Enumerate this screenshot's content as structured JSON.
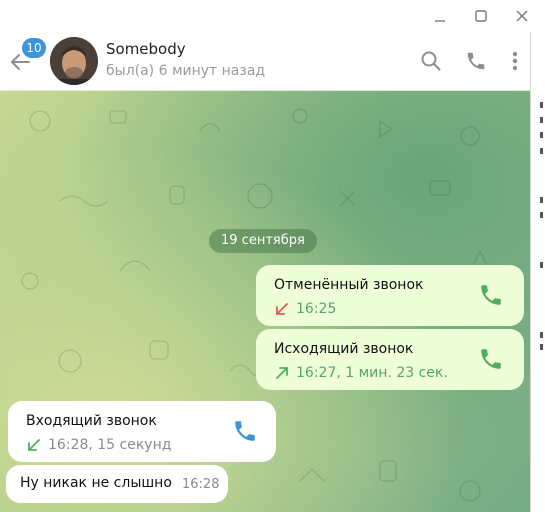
{
  "window": {
    "controls": [
      "minimize-icon",
      "maximize-icon",
      "close-icon"
    ]
  },
  "header": {
    "unread_badge": "10",
    "contact_name": "Somebody",
    "status": "был(а) 6 минут назад",
    "icons": [
      "back-arrow-icon",
      "search-icon",
      "phone-icon",
      "more-vertical-icon"
    ]
  },
  "chat": {
    "date": "19 сентября",
    "messages": [
      {
        "direction": "outgoing",
        "title": "Отменённый звонок",
        "meta": "16:25",
        "arrow": "missed-arrow-icon",
        "arrow_color": "#e05a4f"
      },
      {
        "direction": "outgoing",
        "title": "Исходящий звонок",
        "meta": "16:27, 1 мин. 23 сек.",
        "arrow": "outgoing-arrow-icon",
        "arrow_color": "#4fae5f"
      },
      {
        "direction": "incoming",
        "title": "Входящий звонок",
        "meta": "16:28, 15 секунд",
        "arrow": "incoming-arrow-icon",
        "arrow_color": "#4fae5f"
      },
      {
        "direction": "incoming",
        "text": "Ну никак не слышно",
        "time": "16:28"
      }
    ]
  },
  "colors": {
    "accent": "#3a95dd",
    "outgoing_bubble": "#eefed7",
    "incoming_bubble": "#ffffff",
    "call_icon_outgoing": "#4fae5f",
    "call_icon_incoming": "#3a95dd"
  }
}
